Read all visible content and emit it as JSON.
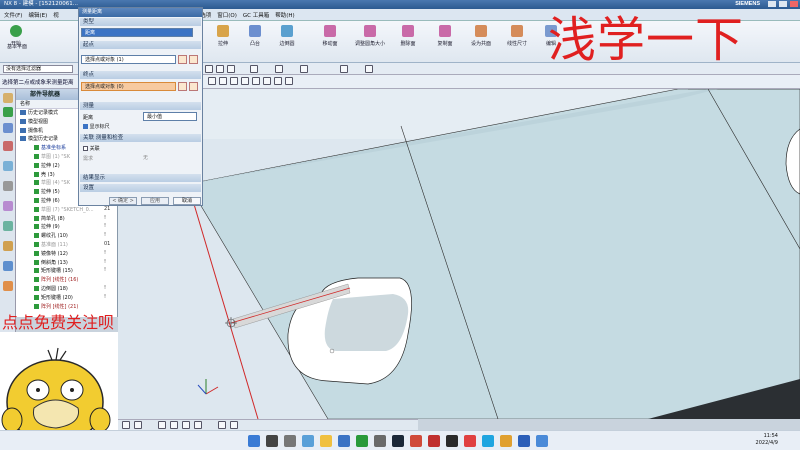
{
  "window": {
    "title": "NX 8 - 建模 - [152120061..."
  },
  "menubar": {
    "items": [
      "文件(F)",
      "编辑(E)",
      "视",
      "首选项",
      "窗口(O)",
      "GC 工具箱",
      "帮助(H)"
    ]
  },
  "brand": "SIEMENS",
  "ribbon": {
    "start_label": "开始",
    "items": [
      "基本平面",
      "拉伸",
      "凸台",
      "边倒圆",
      "移动面",
      "调整圆角大小",
      "删除面",
      "复制面",
      "设为共面",
      "线性尺寸",
      "编辑"
    ]
  },
  "selection_filter": "没有选择过滤器",
  "status_prompt": "选择第二点或成象来测量距离",
  "dialog": {
    "title": "测量距离",
    "sections": {
      "type": "类型",
      "start_point": "起点",
      "end_point": "终点",
      "measure": "测量",
      "associated": "关联 测量和检查",
      "result_display": "结果显示",
      "settings": "设置"
    },
    "type_value": "距离",
    "start_point_value": "选择点或对象 (1)",
    "end_point_value": "选择点或对象 (0)",
    "distance_label": "距离",
    "distance_value": "最小值",
    "display_line_label": "显示标尺",
    "associated_label": "关联",
    "requirement_label": "需求",
    "requirement_value": "无",
    "buttons": {
      "ok": "< 确定 >",
      "apply": "应用",
      "cancel": "取消"
    }
  },
  "navigator": {
    "title": "部件导航器",
    "header_name": "名称",
    "rows": [
      {
        "label": "历史记录模式",
        "color": "normal",
        "mark": ""
      },
      {
        "label": "模型视图",
        "color": "normal",
        "mark": ""
      },
      {
        "label": "摄像机",
        "color": "normal",
        "mark": ""
      },
      {
        "label": "模型历史记录",
        "color": "normal",
        "mark": ""
      },
      {
        "label": "基准坐标系",
        "color": "blue",
        "mark": ""
      },
      {
        "label": "草图 (1) \"SK",
        "color": "grey",
        "mark": ""
      },
      {
        "label": "拉伸 (2)",
        "color": "normal",
        "mark": ""
      },
      {
        "label": "壳 (3)",
        "color": "normal",
        "mark": ""
      },
      {
        "label": "草图 (4) \"SK",
        "color": "grey",
        "mark": ""
      },
      {
        "label": "拉伸 (5)",
        "color": "normal",
        "mark": ""
      },
      {
        "label": "拉伸 (6)",
        "color": "normal",
        "mark": "!"
      },
      {
        "label": "草图 (7) \"SKETCH_0...",
        "color": "grey",
        "mark": "21"
      },
      {
        "label": "简单孔 (8)",
        "color": "normal",
        "mark": "!"
      },
      {
        "label": "拉伸 (9)",
        "color": "normal",
        "mark": "!"
      },
      {
        "label": "螺纹孔 (10)",
        "color": "normal",
        "mark": "!"
      },
      {
        "label": "基准面 (11)",
        "color": "grey",
        "mark": "01"
      },
      {
        "label": "镜像特 (12)",
        "color": "normal",
        "mark": "!"
      },
      {
        "label": "倒斜角 (13)",
        "color": "normal",
        "mark": "!"
      },
      {
        "label": "矩形键槽 (15)",
        "color": "normal",
        "mark": "!"
      },
      {
        "label": "阵列 [线性] (16)",
        "color": "red",
        "mark": ""
      },
      {
        "label": "边倒圆 (18)",
        "color": "normal",
        "mark": "!"
      },
      {
        "label": "矩形键槽 (20)",
        "color": "normal",
        "mark": "!"
      },
      {
        "label": "阵列 [线性] (21)",
        "color": "red",
        "mark": ""
      }
    ]
  },
  "overlay": {
    "headline": "浅学一下",
    "follow": "点点免费关注呗"
  },
  "taskbar": {
    "time": "11:54",
    "date": "2022/4/9"
  },
  "colors": {
    "accent_blue": "#3b73c4",
    "overlay_red": "#e02020",
    "part_face": "#c5dbe2",
    "edge_red": "#d02828"
  }
}
